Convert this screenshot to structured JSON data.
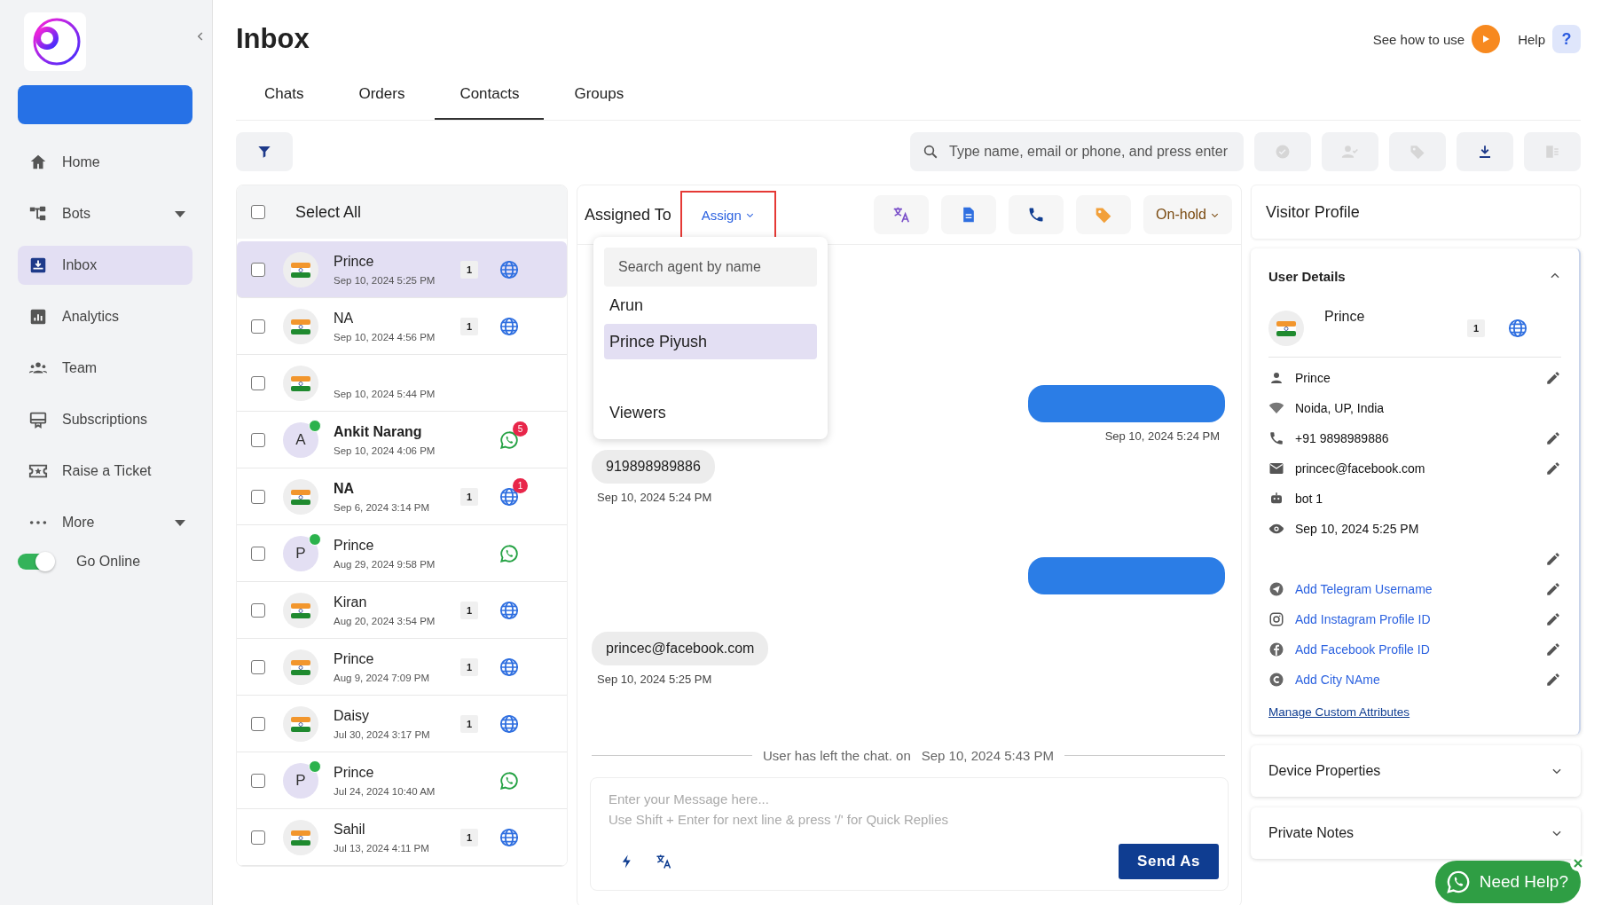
{
  "sidebar": {
    "items": [
      {
        "label": "Home",
        "selected": false,
        "submenu": false
      },
      {
        "label": "Bots",
        "selected": false,
        "submenu": true
      },
      {
        "label": "Inbox",
        "selected": true,
        "submenu": false
      },
      {
        "label": "Analytics",
        "selected": false,
        "submenu": false
      },
      {
        "label": "Team",
        "selected": false,
        "submenu": false
      },
      {
        "label": "Subscriptions",
        "selected": false,
        "submenu": false
      },
      {
        "label": "Raise a Ticket",
        "selected": false,
        "submenu": false
      },
      {
        "label": "More",
        "selected": false,
        "submenu": true
      }
    ],
    "online_toggle": {
      "label": "Go Online",
      "on": true
    }
  },
  "page_title": "Inbox",
  "help_links": {
    "tutorial": "See how to use",
    "help": "Help",
    "help_icon": "?"
  },
  "tabs": [
    {
      "label": "Chats",
      "selected": false
    },
    {
      "label": "Orders",
      "selected": false
    },
    {
      "label": "Contacts",
      "selected": true
    },
    {
      "label": "Groups",
      "selected": false
    }
  ],
  "search": {
    "placeholder": "Type name, email or phone, and press enter"
  },
  "contacts": {
    "select_all": {
      "label": "Select All",
      "checked": false
    },
    "rows": [
      {
        "name": "Prince",
        "time": "Sep 10, 2024 5:25 PM",
        "selected": true,
        "checked": false,
        "count": "1",
        "kind": "web"
      },
      {
        "name": "NA",
        "time": "Sep 10, 2024 4:56 PM",
        "selected": false,
        "checked": false,
        "count": "1",
        "kind": "web"
      },
      {
        "time": "Sep 10, 2024 5:44 PM",
        "selected": false,
        "checked": false
      },
      {
        "name": "Ankit Narang",
        "time": "Sep 10, 2024 4:06 PM",
        "selected": false,
        "checked": false,
        "initial": "A",
        "online": true,
        "kind": "whatsapp",
        "unread": "5"
      },
      {
        "name": "NA",
        "time": "Sep 6, 2024 3:14 PM",
        "selected": false,
        "checked": false,
        "count": "1",
        "kind": "web",
        "unread": "1"
      },
      {
        "name": "Prince",
        "time": "Aug 29, 2024 9:58 PM",
        "selected": false,
        "checked": false,
        "initial": "P",
        "online": true,
        "kind": "whatsapp"
      },
      {
        "name": "Kiran",
        "time": "Aug 20, 2024 3:54 PM",
        "selected": false,
        "checked": false,
        "count": "1",
        "kind": "web"
      },
      {
        "name": "Prince",
        "time": "Aug 9, 2024 7:09 PM",
        "selected": false,
        "checked": false,
        "count": "1",
        "kind": "web"
      },
      {
        "name": "Daisy",
        "time": "Jul 30, 2024 3:17 PM",
        "selected": false,
        "checked": false,
        "count": "1",
        "kind": "web"
      },
      {
        "name": "Prince",
        "time": "Jul 24, 2024 10:40 AM",
        "selected": false,
        "checked": false,
        "initial": "P",
        "online": true,
        "kind": "whatsapp"
      },
      {
        "name": "Sahil",
        "time": "Jul 13, 2024 4:11 PM",
        "selected": false,
        "checked": false,
        "count": "1",
        "kind": "web"
      }
    ]
  },
  "chat": {
    "assigned_label": "Assigned To",
    "assign_button": "Assign",
    "status": "On-hold",
    "agent_menu": {
      "placeholder": "Search agent by name",
      "items": [
        {
          "label": "Arun",
          "selected": false
        },
        {
          "label": "Prince Piyush",
          "selected": true
        },
        {
          "label": "Viewers",
          "selected": false
        }
      ]
    },
    "messages": [
      {
        "kind": "out",
        "time": "Sep 10, 2024 5:24 PM"
      },
      {
        "kind": "in",
        "text": "919898989886",
        "time": "Sep 10, 2024 5:24 PM"
      },
      {
        "kind": "out"
      },
      {
        "kind": "in",
        "text": "princec@facebook.com",
        "time": "Sep 10, 2024 5:25 PM"
      }
    ],
    "system_note": {
      "text": "User has left the chat. on",
      "time": "Sep 10, 2024 5:43 PM"
    },
    "composer": {
      "placeholder": "Enter your Message here...\nUse Shift + Enter for next line & press '/' for Quick Replies",
      "send": "Send As"
    }
  },
  "profile": {
    "title": "Visitor Profile",
    "user_details": {
      "title": "User Details",
      "expanded": true,
      "name": "Prince",
      "count": "1",
      "fields": [
        {
          "kind": "value",
          "text": "Prince",
          "editable": true
        },
        {
          "kind": "value",
          "text": "Noida, UP, India",
          "editable": false
        },
        {
          "kind": "value",
          "text": "+91 9898989886",
          "editable": true
        },
        {
          "kind": "value",
          "text": "princec@facebook.com",
          "editable": true
        },
        {
          "kind": "value",
          "text": "bot 1",
          "editable": false
        },
        {
          "kind": "value",
          "text": "Sep 10, 2024 5:25 PM",
          "editable": false
        },
        {
          "kind": "hidden",
          "editable": true
        },
        {
          "kind": "link",
          "text": "Add Telegram Username",
          "editable": true
        },
        {
          "kind": "link",
          "text": "Add Instagram Profile ID",
          "editable": true
        },
        {
          "kind": "link",
          "text": "Add Facebook Profile ID",
          "editable": true
        },
        {
          "kind": "link",
          "text": "Add City NAme",
          "editable": true
        }
      ],
      "manage_link": "Manage Custom Attributes"
    },
    "sections": [
      {
        "title": "Device Properties",
        "expanded": false
      },
      {
        "title": "Private Notes",
        "expanded": false
      }
    ]
  },
  "need_help": "Need Help?"
}
